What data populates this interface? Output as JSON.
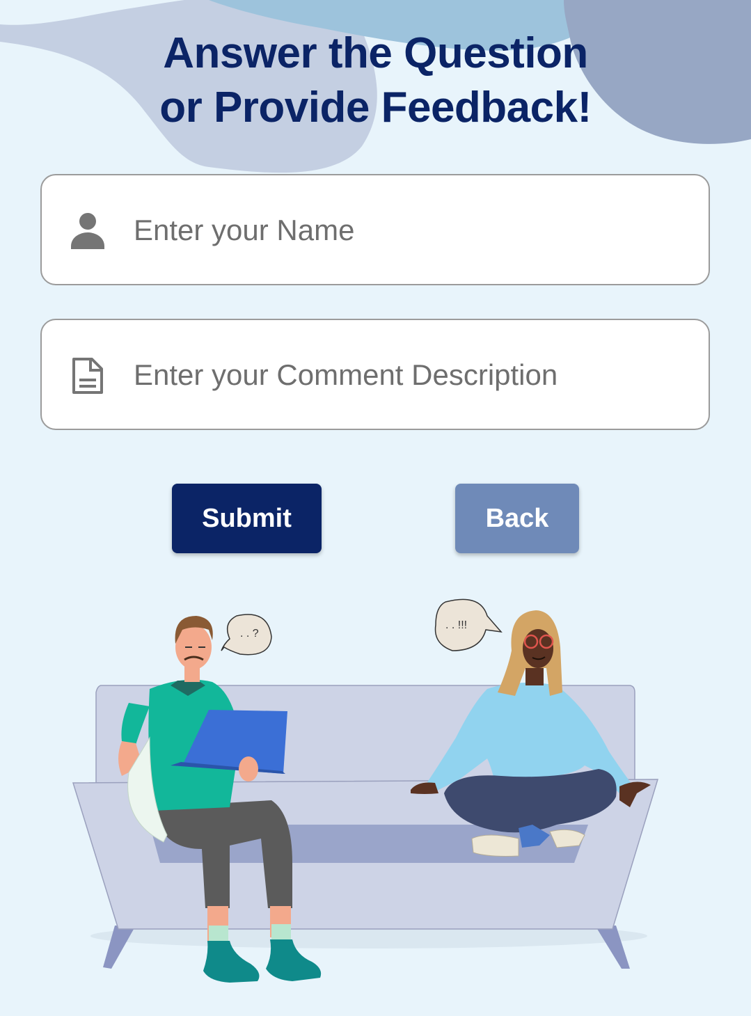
{
  "header": {
    "title_line1": "Answer the Question",
    "title_line2": "or Provide Feedback!"
  },
  "form": {
    "name_field": {
      "placeholder": "Enter your Name",
      "icon": "person-icon"
    },
    "comment_field": {
      "placeholder": "Enter your Comment Description",
      "icon": "document-icon"
    }
  },
  "actions": {
    "submit_label": "Submit",
    "back_label": "Back"
  },
  "illustration": {
    "bubble_left": ". . ?",
    "bubble_right": ". . !!!"
  },
  "colors": {
    "title": "#0b2466",
    "submit": "#0b2466",
    "back": "#6f8ab8",
    "background": "#e8f4fb"
  }
}
